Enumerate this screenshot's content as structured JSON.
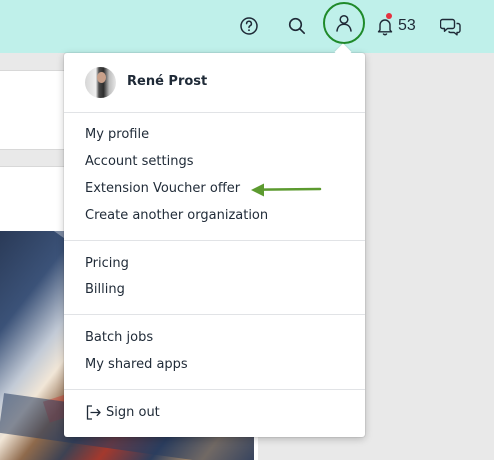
{
  "topbar": {
    "icons": [
      "help-icon",
      "search-icon",
      "user-icon",
      "bell-icon",
      "chat-icon"
    ],
    "notification_count": "53",
    "colors": {
      "background": "#bff0ea",
      "active_ring": "#1f8a2a",
      "notification_dot": "#e5313f"
    }
  },
  "menu": {
    "user_name": "René Prost",
    "section1": [
      "My profile",
      "Account settings",
      "Extension Voucher offer",
      "Create another organization"
    ],
    "section2": [
      "Pricing",
      "Billing"
    ],
    "section3": [
      "Batch jobs",
      "My shared apps"
    ],
    "signout_label": "Sign out"
  },
  "annotation": {
    "arrow_color": "#5c9a2f"
  }
}
